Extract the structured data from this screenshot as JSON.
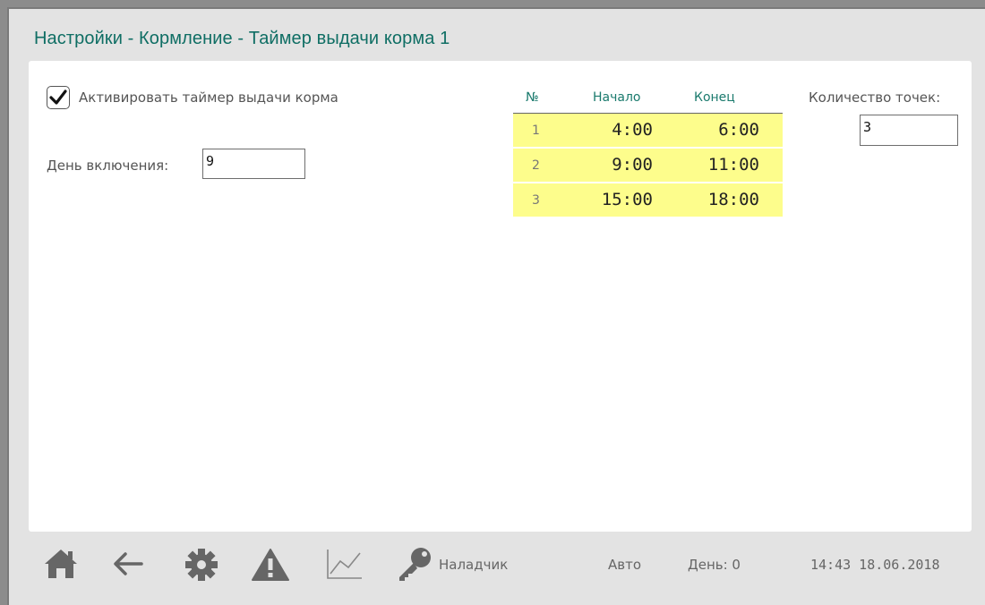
{
  "title": "Настройки - Кормление - Таймер выдачи корма 1",
  "activate": {
    "label": "Активировать таймер выдачи корма",
    "checked": true
  },
  "day_on": {
    "label": "День включения:",
    "value": "9"
  },
  "points": {
    "label": "Количество точек:",
    "value": "3"
  },
  "table": {
    "headers": {
      "no": "№",
      "start": "Начало",
      "end": "Конец"
    },
    "rows": [
      {
        "no": "1",
        "start": "4:00",
        "end": "6:00"
      },
      {
        "no": "2",
        "start": "9:00",
        "end": "11:00"
      },
      {
        "no": "3",
        "start": "15:00",
        "end": "18:00"
      }
    ]
  },
  "footer": {
    "user": "Наладчик",
    "mode": "Авто",
    "day": "День: 0",
    "datetime": "14:43 18.06.2018",
    "icons": [
      "home-icon",
      "back-arrow-icon",
      "gear-icon",
      "warning-icon",
      "chart-icon",
      "key-icon"
    ]
  },
  "colors": {
    "accent": "#0f6e64",
    "table_highlight": "#fdfd8c",
    "icon_gray": "#666666"
  }
}
